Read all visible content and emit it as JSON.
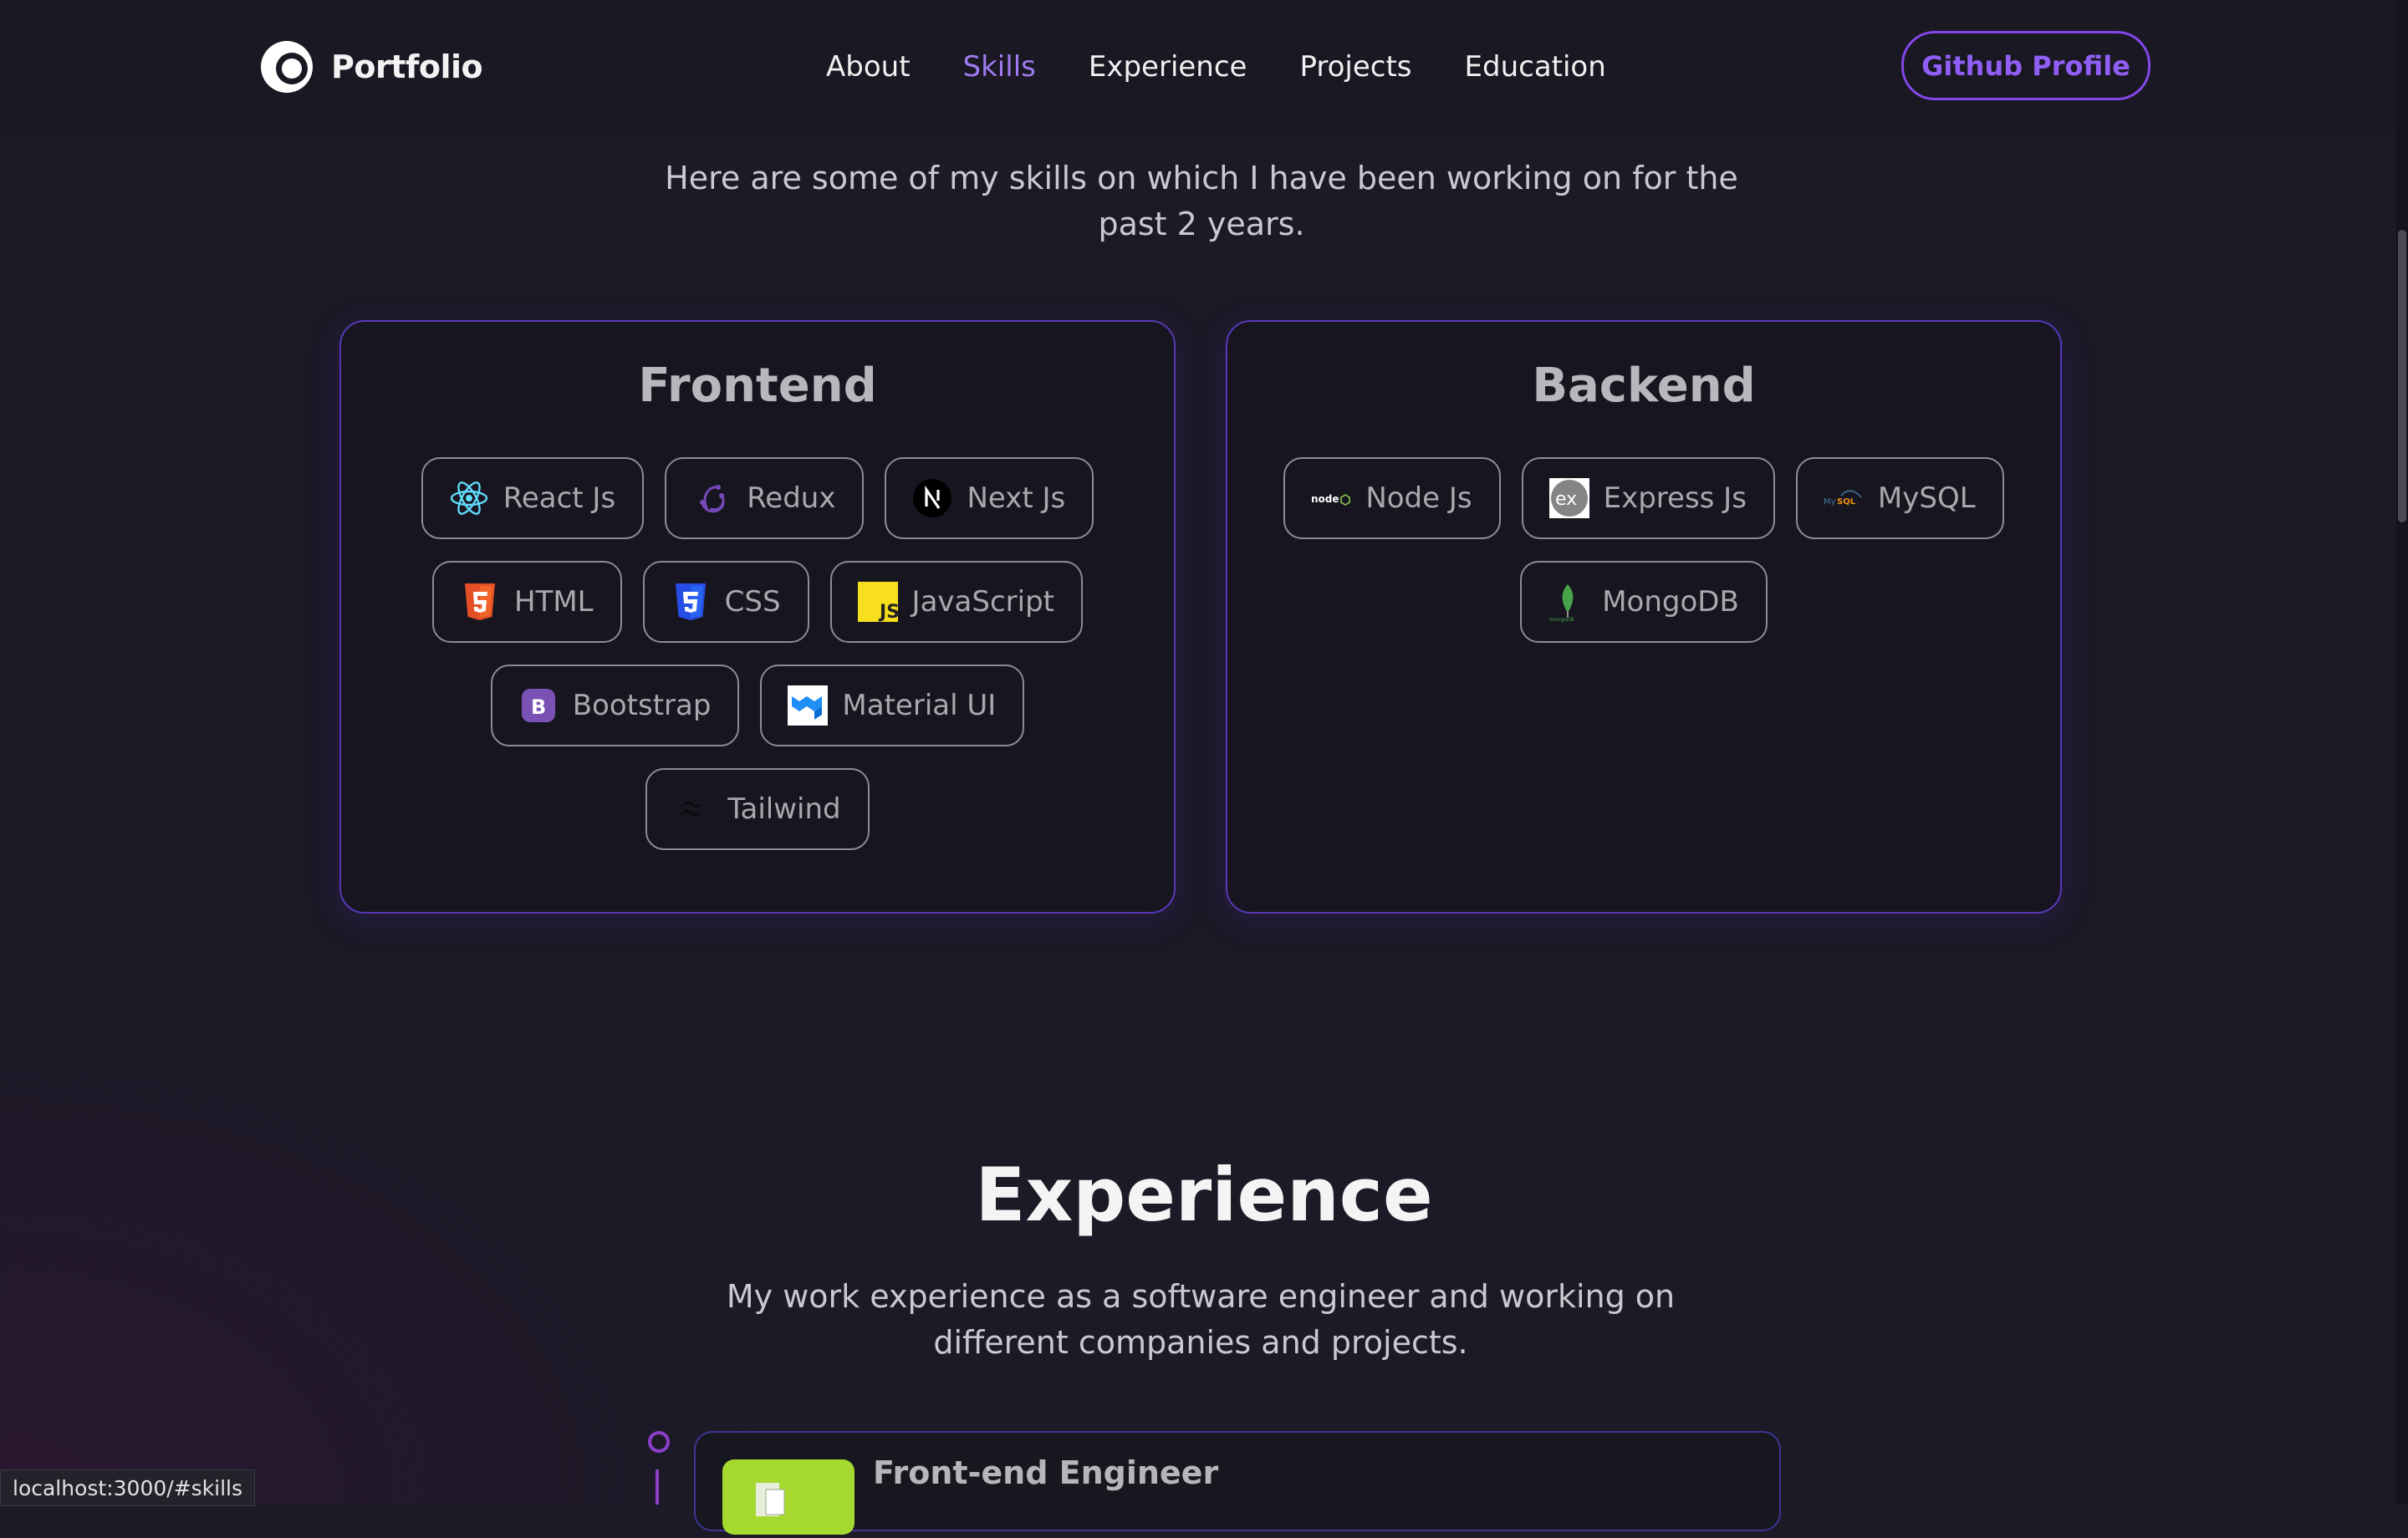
{
  "nav": {
    "logo_text": "Portfolio",
    "links": [
      "About",
      "Skills",
      "Experience",
      "Projects",
      "Education"
    ],
    "active": "Skills",
    "github_button": "Github Profile"
  },
  "skills": {
    "description": "Here are some of my skills on which I have been working on for the past 2 years.",
    "frontend": {
      "title": "Frontend",
      "items": [
        "React Js",
        "Redux",
        "Next Js",
        "HTML",
        "CSS",
        "JavaScript",
        "Bootstrap",
        "Material UI",
        "Tailwind"
      ]
    },
    "backend": {
      "title": "Backend",
      "items": [
        "Node Js",
        "Express Js",
        "MySQL",
        "MongoDB"
      ]
    }
  },
  "experience": {
    "title": "Experience",
    "description": "My work experience as a software engineer and working on different companies and projects.",
    "items": [
      {
        "role": "Front-end Engineer"
      }
    ]
  },
  "status_bar": {
    "url": "localhost:3000/#skills"
  },
  "colors": {
    "accent": "#8447ea",
    "background": "#1b1a26",
    "card_border": "#5837b7"
  }
}
